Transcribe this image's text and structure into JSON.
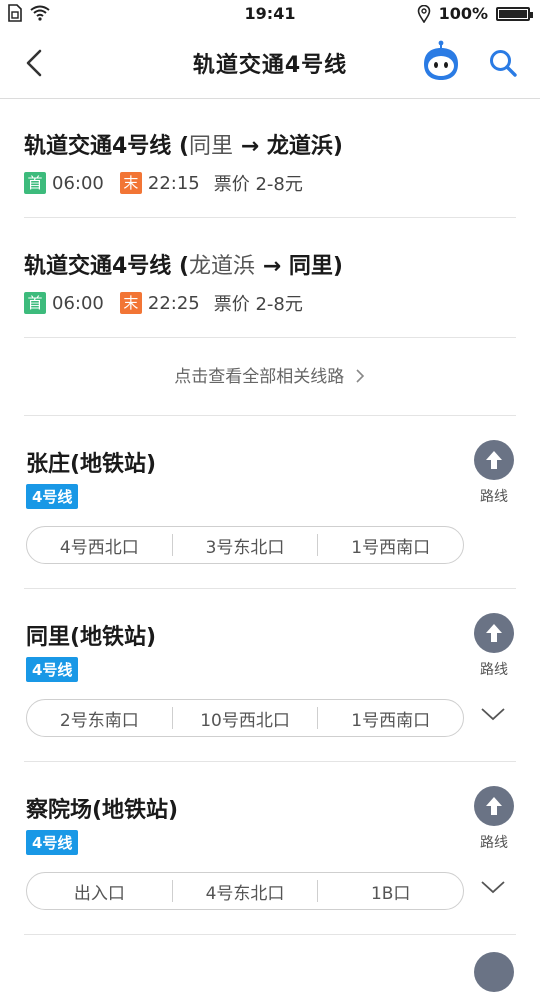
{
  "status_bar": {
    "time": "19:41",
    "battery": "100%"
  },
  "nav": {
    "title": "轨道交通4号线"
  },
  "lines": [
    {
      "name": "轨道交通4号线 (",
      "direction": "同里",
      "arrow": " → ",
      "end": "龙道浜",
      "close": ")",
      "first_tag": "首",
      "first_time": "06:00",
      "last_tag": "末",
      "last_time": "22:15",
      "price": "票价 2-8元"
    },
    {
      "name": "轨道交通4号线 (",
      "direction": "龙道浜",
      "arrow": " → ",
      "end": "同里",
      "close": ")",
      "first_tag": "首",
      "first_time": "06:00",
      "last_tag": "末",
      "last_time": "22:25",
      "price": "票价 2-8元"
    }
  ],
  "all_lines_link": "点击查看全部相关线路",
  "stations": [
    {
      "name": "张庄(地铁站)",
      "line": "4号线",
      "exits": [
        "4号西北口",
        "3号东北口",
        "1号西南口"
      ],
      "route_label": "路线"
    },
    {
      "name": "同里(地铁站)",
      "line": "4号线",
      "exits": [
        "2号东南口",
        "10号西北口",
        "1号西南口"
      ],
      "route_label": "路线"
    },
    {
      "name": "察院场(地铁站)",
      "line": "4号线",
      "exits": [
        "出入口",
        "4号东北口",
        "1B口"
      ],
      "route_label": "路线"
    }
  ],
  "colors": {
    "accent": "#1998e6",
    "first": "#3dbb7c",
    "last": "#f27535",
    "route": "#6a7385"
  }
}
